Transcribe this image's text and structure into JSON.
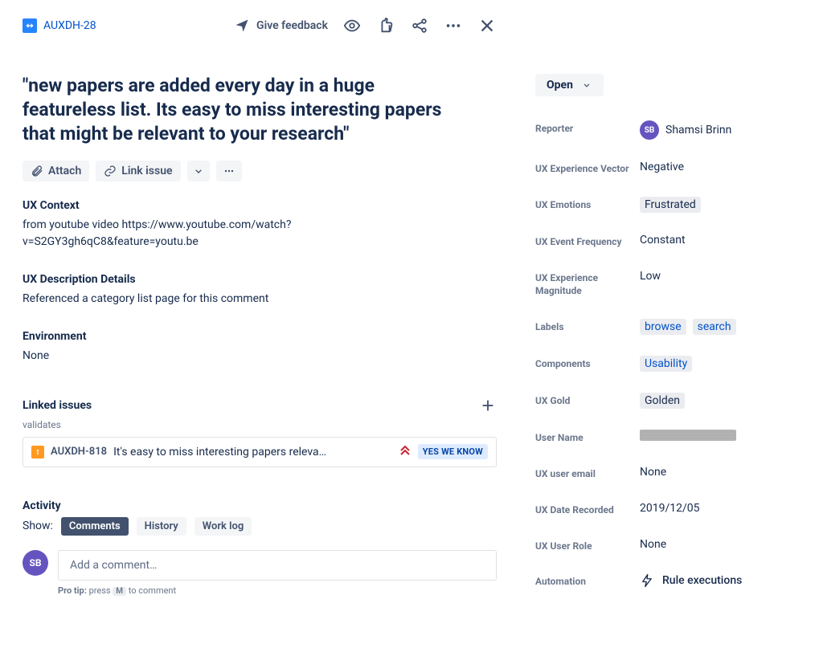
{
  "crumb": {
    "key": "AUXDH-28"
  },
  "feedback_label": "Give feedback",
  "title": "\"new papers are added every day in a huge featureless list. Its easy to miss interesting papers that might be relevant to your research\"",
  "actions": {
    "attach": "Attach",
    "link_issue": "Link issue"
  },
  "sections": {
    "ux_context_label": "UX Context",
    "ux_context_text": "from youtube video https://www.youtube.com/watch?v=S2GY3gh6qC8&feature=youtu.be",
    "ux_desc_label": "UX Description Details",
    "ux_desc_text": "Referenced a category list page for this comment",
    "env_label": "Environment",
    "env_text": "None"
  },
  "linked": {
    "header": "Linked issues",
    "relation": "validates",
    "item": {
      "key": "AUXDH-818",
      "summary": "It's easy to miss interesting papers releva…",
      "status": "YES WE KNOW"
    }
  },
  "activity": {
    "header": "Activity",
    "show_label": "Show:",
    "tabs": {
      "comments": "Comments",
      "history": "History",
      "worklog": "Work log"
    },
    "avatar_initials": "SB",
    "comment_placeholder": "Add a comment…",
    "protip_bold": "Pro tip:",
    "protip_before": "press",
    "protip_key": "M",
    "protip_after": "to comment"
  },
  "status": {
    "label": "Open"
  },
  "fields": {
    "reporter_label": "Reporter",
    "reporter_name": "Shamsi Brinn",
    "reporter_initials": "SB",
    "vector_label": "UX Experience Vector",
    "vector_val": "Negative",
    "emotions_label": "UX Emotions",
    "emotions_val": "Frustrated",
    "freq_label": "UX Event Frequency",
    "freq_val": "Constant",
    "magnitude_label": "UX Experience Magnitude",
    "magnitude_val": "Low",
    "labels_label": "Labels",
    "label1": "browse",
    "label2": "search",
    "components_label": "Components",
    "component1": "Usability",
    "gold_label": "UX Gold",
    "gold_val": "Golden",
    "username_label": "User Name",
    "useremail_label": "UX user email",
    "useremail_val": "None",
    "date_label": "UX Date Recorded",
    "date_val": "2019/12/05",
    "role_label": "UX User Role",
    "role_val": "None",
    "automation_label": "Automation",
    "automation_val": "Rule executions"
  }
}
